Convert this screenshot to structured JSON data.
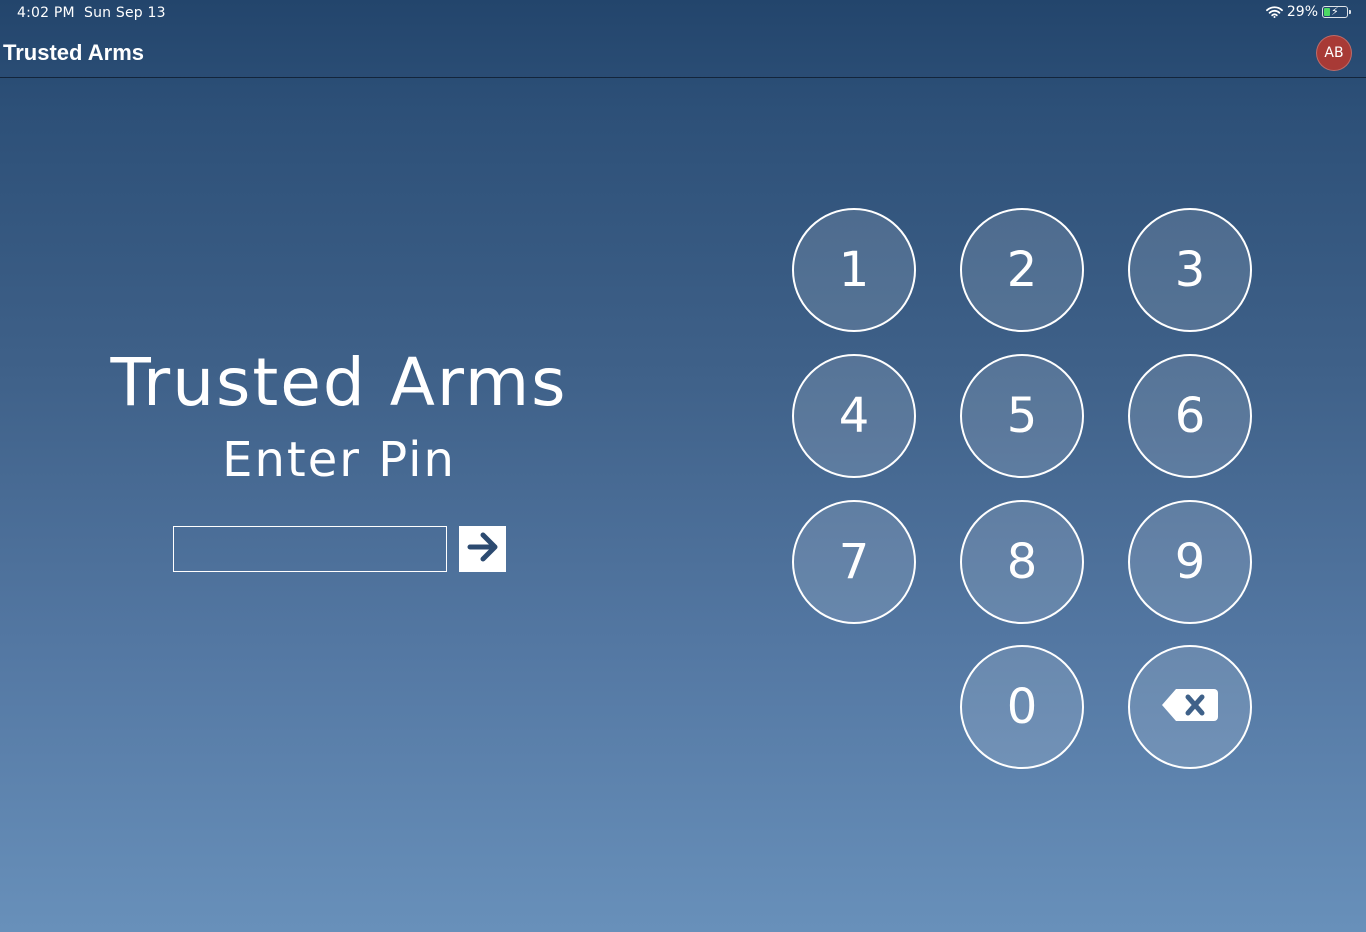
{
  "status_bar": {
    "time": "4:02 PM",
    "date": "Sun Sep 13",
    "battery_percent": "29%",
    "battery_level": 0.29,
    "battery_charging": true,
    "wifi_icon": "wifi-icon",
    "battery_icon": "battery-charging-icon"
  },
  "nav": {
    "title": "Trusted Arms",
    "avatar_initials": "AB",
    "avatar_color": "#a83a36"
  },
  "login": {
    "title": "Trusted Arms",
    "prompt": "Enter Pin",
    "pin_value": "",
    "submit_icon": "arrow-right-icon"
  },
  "keypad": {
    "keys": [
      "1",
      "2",
      "3",
      "4",
      "5",
      "6",
      "7",
      "8",
      "9",
      "0"
    ],
    "backspace_icon": "backspace-icon"
  },
  "colors": {
    "accent": "#2c4a70",
    "background_top": "#23456c",
    "background_bottom": "#6890ba"
  }
}
